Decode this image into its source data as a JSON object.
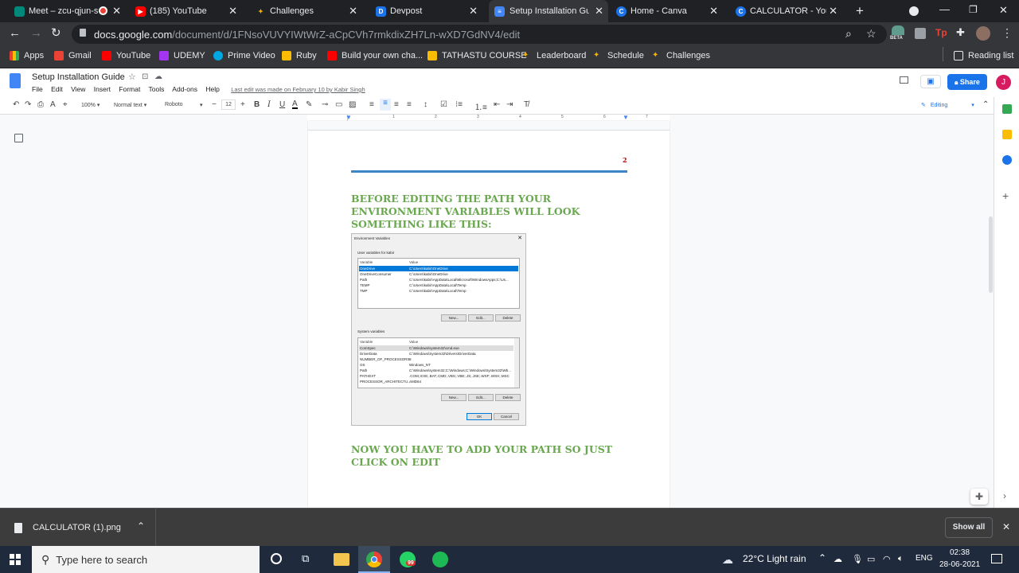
{
  "tabs": [
    {
      "label": "Meet – zcu-qjun-s",
      "icon": "meet-icon",
      "color": "#00897b",
      "glyph": ""
    },
    {
      "label": "(185) YouTube",
      "icon": "youtube-icon",
      "color": "#ff0000",
      "glyph": "▶"
    },
    {
      "label": "Challenges",
      "icon": "wand-icon",
      "color": "#f4b400",
      "glyph": "✦"
    },
    {
      "label": "Devpost",
      "icon": "devpost-icon",
      "color": "#1a73e8",
      "glyph": "D"
    },
    {
      "label": "Setup Installation Gui",
      "icon": "docs-icon",
      "color": "#4285f4",
      "glyph": "≡"
    },
    {
      "label": "Home - Canva",
      "icon": "canva-icon",
      "color": "#1a73e8",
      "glyph": "C"
    },
    {
      "label": "CALCULATOR - YouTu",
      "icon": "canva-icon",
      "color": "#1a73e8",
      "glyph": "C"
    }
  ],
  "omnibox": {
    "host": "docs.google.com",
    "path": "/document/d/1FNsoVUVYIWtWrZ-aCpCVh7rmkdixZH7Ln-wXD7GdNV4/edit"
  },
  "extension_badge": "BETA",
  "bookmarks": [
    {
      "label": "Apps",
      "color": "#ea4335"
    },
    {
      "label": "Gmail",
      "color": "#ea4335"
    },
    {
      "label": "YouTube",
      "color": "#ff0000"
    },
    {
      "label": "UDEMY",
      "color": "#a435f0"
    },
    {
      "label": "Prime Video",
      "color": "#00a8e1"
    },
    {
      "label": "Ruby",
      "color": "#fbbc04"
    },
    {
      "label": "Build your own cha...",
      "color": "#ff0000"
    },
    {
      "label": "TATHASTU COURSE",
      "color": "#fbbc04"
    },
    {
      "label": "Leaderboard",
      "color": "#f4b400"
    },
    {
      "label": "Schedule",
      "color": "#f4b400"
    },
    {
      "label": "Challenges",
      "color": "#f4b400"
    }
  ],
  "reading_list": "Reading list",
  "doc": {
    "title": "Setup Installation Guide",
    "menu": [
      "File",
      "Edit",
      "View",
      "Insert",
      "Format",
      "Tools",
      "Add-ons",
      "Help"
    ],
    "last_edit": "Last edit was made on February 10 by Kabir Singh",
    "share_label": "Share",
    "avatar_letter": "J",
    "mode": "Editing"
  },
  "format_toolbar": {
    "zoom": "100%",
    "style": "Normal text",
    "font": "Roboto",
    "size": "12"
  },
  "ruler_marks": [
    "1",
    "2",
    "3",
    "4",
    "5",
    "6",
    "7"
  ],
  "page": {
    "page_number": "2",
    "heading1": "BEFORE EDITING THE PATH YOUR ENVIRONMENT VARIABLES WILL LOOK SOMETHING LIKE THIS:",
    "heading2": "NOW YOU HAVE TO ADD YOUR PATH SO JUST CLICK ON EDIT"
  },
  "dialog": {
    "title": "Environment Variables",
    "user_section": "User variables for kabir",
    "col_variable": "Variable",
    "col_value": "Value",
    "user_rows": [
      {
        "var": "OneDrive",
        "val": "C:\\Users\\kabir\\OneDrive"
      },
      {
        "var": "OneDriveConsumer",
        "val": "C:\\Users\\kabir\\OneDrive"
      },
      {
        "var": "Path",
        "val": "C:\\Users\\kabir\\AppData\\Local\\Microsoft\\WindowsApps;C:\\Us..."
      },
      {
        "var": "TEMP",
        "val": "C:\\Users\\kabir\\AppData\\Local\\Temp"
      },
      {
        "var": "TMP",
        "val": "C:\\Users\\kabir\\AppData\\Local\\Temp"
      }
    ],
    "system_section": "System variables",
    "system_rows": [
      {
        "var": "ComSpec",
        "val": "C:\\Windows\\system32\\cmd.exe"
      },
      {
        "var": "DriverData",
        "val": "C:\\Windows\\System32\\Drivers\\DriverData"
      },
      {
        "var": "NUMBER_OF_PROCESSORS",
        "val": "8"
      },
      {
        "var": "OS",
        "val": "Windows_NT"
      },
      {
        "var": "Path",
        "val": "C:\\Windows\\system32;C:\\Windows;C:\\Windows\\System32\\Wb..."
      },
      {
        "var": "PATHEXT",
        "val": ".COM;.EXE;.BAT;.CMD;.VBS;.VBE;.JS;.JSE;.WSF;.WSH;.MSC"
      },
      {
        "var": "PROCESSOR_ARCHITECTU...",
        "val": "AMD64"
      }
    ],
    "btn_new": "New...",
    "btn_edit": "Edit...",
    "btn_delete": "Delete",
    "btn_ok": "OK",
    "btn_cancel": "Cancel"
  },
  "download": {
    "filename": "CALCULATOR (1).png",
    "show_all": "Show all"
  },
  "taskbar": {
    "search_placeholder": "Type here to search",
    "whatsapp_badge": "99",
    "weather": "22°C  Light rain",
    "lang": "ENG",
    "time": "02:38",
    "date": "28-06-2021"
  }
}
